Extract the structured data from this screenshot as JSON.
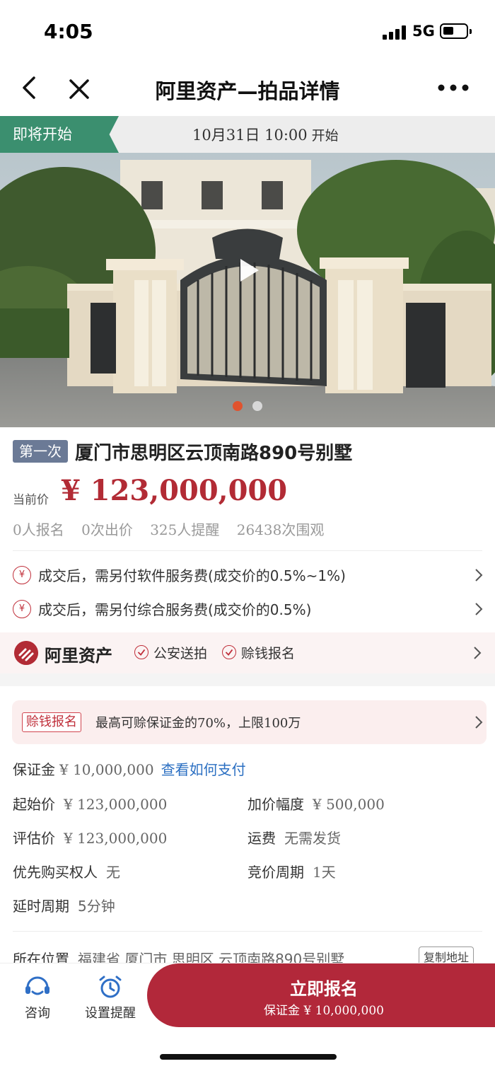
{
  "status_bar": {
    "time": "4:05",
    "network": "5G"
  },
  "nav": {
    "title": "阿里资产—拍品详情"
  },
  "auction": {
    "state_tag": "即将开始",
    "start_time": "10月31日 10:00",
    "start_suffix": "开始"
  },
  "carousel": {
    "slide_count": 2,
    "active_index": 0,
    "active_color": "#e0532e",
    "inactive_color": "#d8d8d8"
  },
  "lot": {
    "round_badge": "第一次",
    "title": "厦门市思明区云顶南路890号别墅",
    "price_label": "当前价",
    "price": "¥ 123,000,000",
    "stats": [
      "0人报名",
      "0次出价",
      "325人提醒",
      "26438次围观"
    ]
  },
  "fees": [
    {
      "icon": "¥",
      "text": "成交后，需另付软件服务费(成交价的0.5%~1%)"
    },
    {
      "icon": "¥",
      "text": "成交后，需另付综合服务费(成交价的0.5%)"
    }
  ],
  "brand": {
    "name": "阿里资产",
    "badges": [
      "公安送拍",
      "赊钱报名"
    ]
  },
  "promo": {
    "tag": "赊钱报名",
    "text": "最高可赊保证金的70%，上限100万"
  },
  "deposit": {
    "label": "保证金",
    "value": "¥ 10,000,000",
    "link": "查看如何支付"
  },
  "details": {
    "start_price": {
      "label": "起始价",
      "value": "¥ 123,000,000"
    },
    "increment": {
      "label": "加价幅度",
      "value": "¥ 500,000"
    },
    "appraisal": {
      "label": "评估价",
      "value": "¥ 123,000,000"
    },
    "shipping": {
      "label": "运费",
      "value": "无需发货"
    },
    "priority_buyer": {
      "label": "优先购买权人",
      "value": "无"
    },
    "bidding_period": {
      "label": "竞价周期",
      "value": "1天"
    },
    "extension": {
      "label": "延时周期",
      "value": "5分钟"
    }
  },
  "location": {
    "label": "所在位置",
    "value": "福建省 厦门市 思明区 云顶南路890号别墅",
    "copy_button": "复制地址"
  },
  "bottom_bar": {
    "consult": "咨询",
    "reminder": "设置提醒",
    "signup_main": "立即报名",
    "signup_sub": "保证金 ¥ 10,000,000"
  },
  "colors": {
    "accent_red": "#b2283a",
    "tag_green": "#3b8f6f",
    "link_blue": "#2b6fc2",
    "icon_blue": "#2f6fc6"
  }
}
